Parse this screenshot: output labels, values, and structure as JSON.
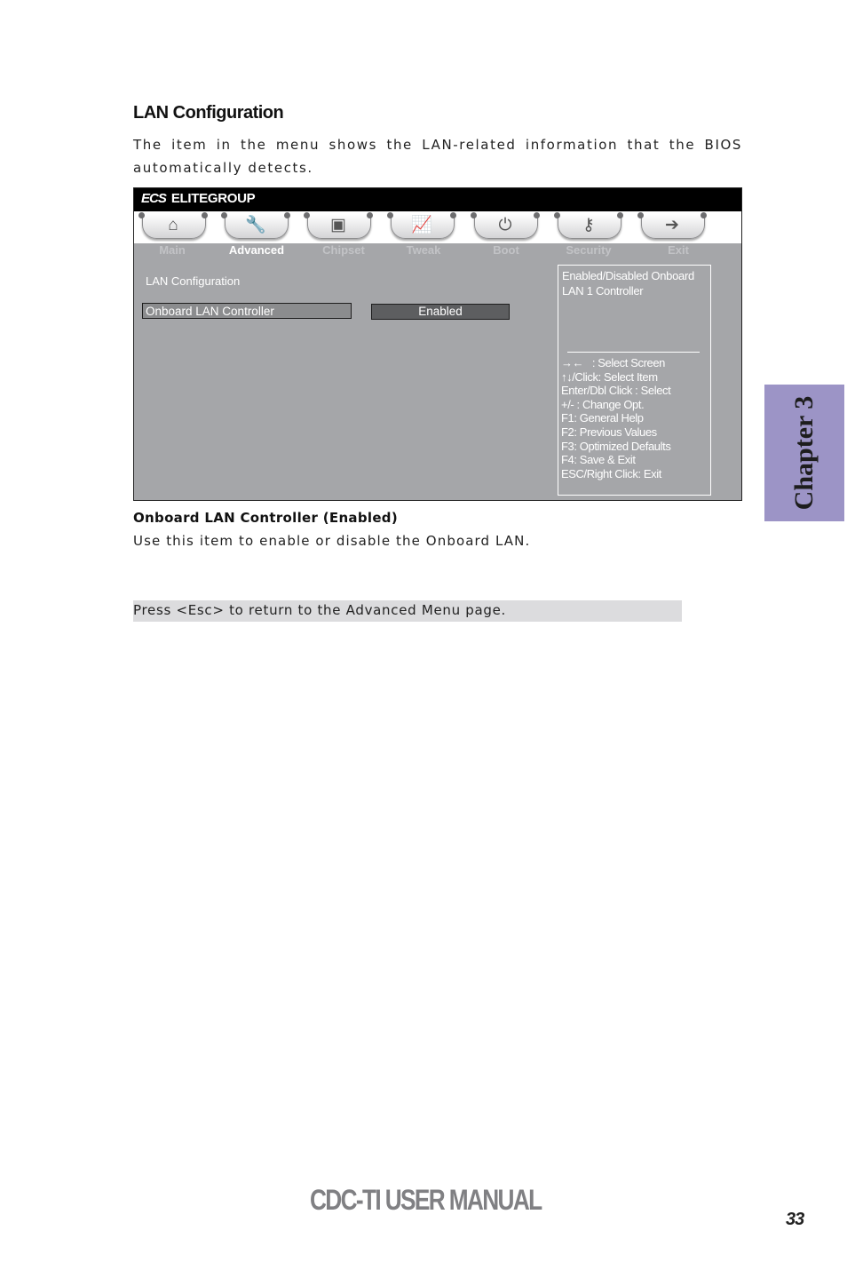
{
  "section": {
    "title": "LAN Configuration",
    "intro_line1": "The item in the menu shows the LAN-related information that the BIOS",
    "intro_line2": "automatically detects."
  },
  "bios": {
    "brand_logo": "ECS",
    "brand_name": "ELITEGROUP",
    "tabs": [
      {
        "label": "Main",
        "icon": "home-icon",
        "glyph": "⌂",
        "active": false
      },
      {
        "label": "Advanced",
        "icon": "wrench-icon",
        "glyph": "🔧",
        "active": true
      },
      {
        "label": "Chipset",
        "icon": "chip-icon",
        "glyph": "▣",
        "active": false
      },
      {
        "label": "Tweak",
        "icon": "chart-icon",
        "glyph": "📈",
        "active": false
      },
      {
        "label": "Boot",
        "icon": "power-icon",
        "glyph": "⏻",
        "active": false
      },
      {
        "label": "Security",
        "icon": "key-icon",
        "glyph": "⚷",
        "active": false
      },
      {
        "label": "Exit",
        "icon": "exit-door-icon",
        "glyph": "➔",
        "active": false
      }
    ],
    "heading": "LAN Configuration",
    "item": {
      "label": "Onboard LAN  Controller",
      "value": "Enabled"
    },
    "help": {
      "description": "Enabled/Disabled Onboard LAN 1 Controller",
      "keys": [
        "→←   : Select Screen",
        "↑↓/Click: Select Item",
        "Enter/Dbl Click : Select",
        "+/- : Change Opt.",
        "F1: General Help",
        "F2: Previous Values",
        "F3: Optimized Defaults",
        "F4: Save & Exit",
        "ESC/Right Click: Exit"
      ]
    }
  },
  "item_doc": {
    "title": "Onboard LAN Controller (Enabled)",
    "description": "Use this item to enable or disable the Onboard LAN."
  },
  "note": "Press <Esc> to return to the Advanced Menu page.",
  "chapter_tab": {
    "label": "Chapter 3",
    "color": "#9c94c6"
  },
  "footer": {
    "title": "CDC-TI USER MANUAL",
    "page_number": "33"
  }
}
